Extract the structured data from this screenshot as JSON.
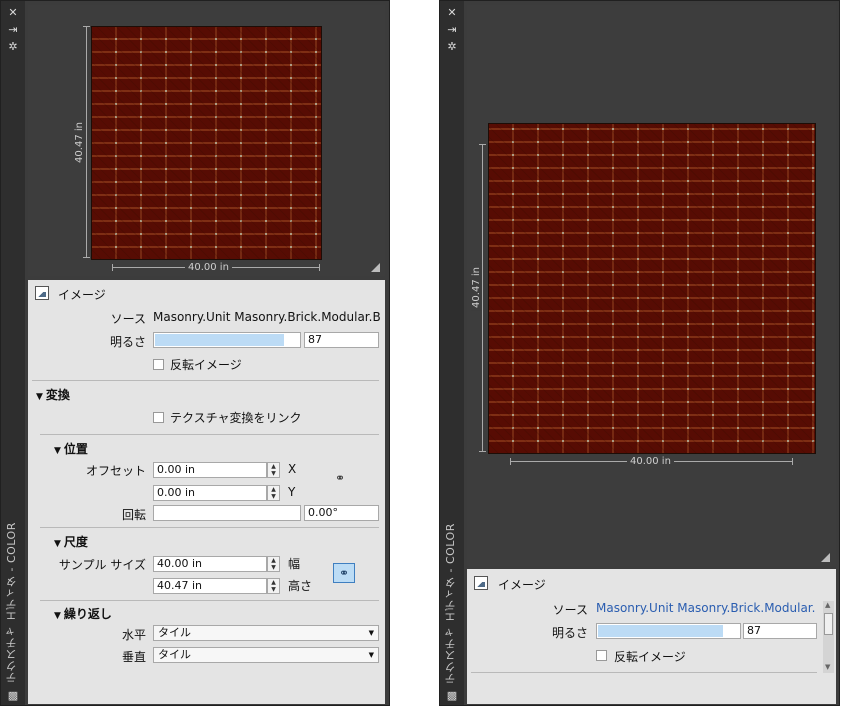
{
  "left_panel": {
    "title": "テクスチャ エディタ - COLOR",
    "icons": [
      "close-icon",
      "pin-icon",
      "settings-icon",
      "texture-icon"
    ],
    "preview": {
      "width_label": "40.00 in",
      "height_label": "40.47 in"
    },
    "image_section": {
      "header": "イメージ",
      "source_label": "ソース",
      "source_value": "Masonry.Unit Masonry.Brick.Modular.Ba",
      "brightness_label": "明るさ",
      "brightness_value": "87",
      "brightness_fraction": 0.87,
      "invert_label": "反転イメージ",
      "invert_checked": false
    },
    "transform_section": {
      "header": "変換",
      "link_label": "テクスチャ変換をリンク",
      "link_checked": false
    },
    "position_section": {
      "header": "位置",
      "offset_label": "オフセット",
      "offset_x": "0.00 in",
      "offset_y": "0.00 in",
      "x_label": "X",
      "y_label": "Y",
      "rotation_label": "回転",
      "rotation_value": "0.00°"
    },
    "scale_section": {
      "header": "尺度",
      "sample_size_label": "サンプル サイズ",
      "width_value": "40.00 in",
      "height_value": "40.47 in",
      "width_label": "幅",
      "height_label": "高さ"
    },
    "repeat_section": {
      "header": "繰り返し",
      "horizontal_label": "水平",
      "horizontal_value": "タイル",
      "vertical_label": "垂直",
      "vertical_value": "タイル"
    }
  },
  "right_panel": {
    "title": "テクスチャ エディタ - COLOR",
    "icons": [
      "close-icon",
      "pin-icon",
      "settings-icon",
      "texture-icon"
    ],
    "preview": {
      "width_label": "40.00 in",
      "height_label": "40.47 in"
    },
    "image_section": {
      "header": "イメージ",
      "source_label": "ソース",
      "source_value": "Masonry.Unit Masonry.Brick.Modular.",
      "brightness_label": "明るさ",
      "brightness_value": "87",
      "brightness_fraction": 0.87,
      "invert_label": "反転イメージ",
      "invert_checked": false
    }
  },
  "colors": {
    "panel_bg": "#3c3c3c",
    "props_bg": "#e4e4e4",
    "accent": "#3f7fc0",
    "link_text": "#2a5db0"
  }
}
